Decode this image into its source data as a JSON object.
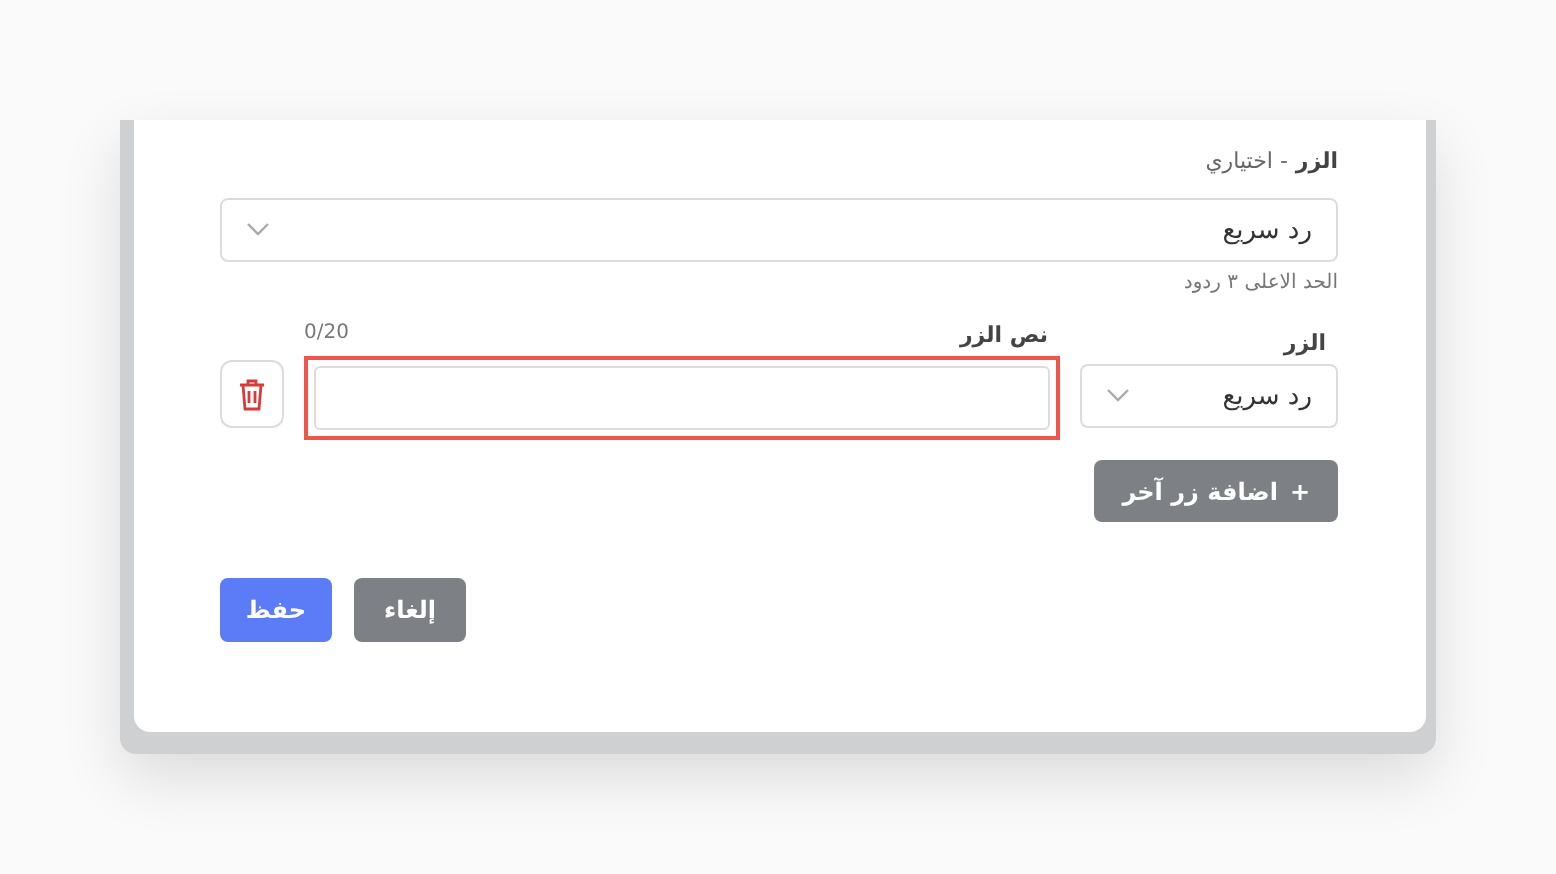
{
  "dialog": {
    "button_type_field": {
      "label": "الزر",
      "optional": "- اختياري",
      "value": "رد سريع",
      "helper": "الحد الاعلى ٣ ردود"
    },
    "button_rows": [
      {
        "type_label": "الزر",
        "type_value": "رد سريع",
        "text_label": "نص الزر",
        "counter": "0/20",
        "invalid": true
      }
    ],
    "add_button": {
      "icon": "+",
      "label": "اضافة زر آخر"
    },
    "actions": [
      {
        "kind": "secondary",
        "label": "إلغاء"
      },
      {
        "kind": "primary",
        "label": "حفظ"
      }
    ]
  }
}
